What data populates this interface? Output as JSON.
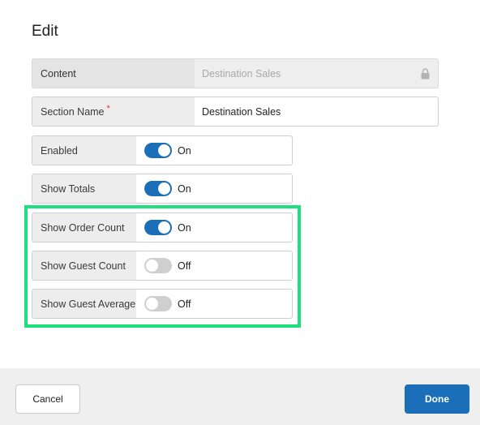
{
  "dialog": {
    "title": "Edit"
  },
  "fields": {
    "content": {
      "label": "Content",
      "value": "Destination Sales",
      "locked": true
    },
    "section_name": {
      "label": "Section Name",
      "required_mark": "*",
      "value": "Destination Sales"
    }
  },
  "toggles": [
    {
      "label": "Enabled",
      "state": "On",
      "on": true
    },
    {
      "label": "Show Totals",
      "state": "On",
      "on": true
    },
    {
      "label": "Show Order Count",
      "state": "On",
      "on": true
    },
    {
      "label": "Show Guest Count",
      "state": "Off",
      "on": false
    },
    {
      "label": "Show Guest Average",
      "state": "Off",
      "on": false
    }
  ],
  "footer": {
    "cancel_label": "Cancel",
    "done_label": "Done"
  },
  "colors": {
    "primary": "#1a6fb8",
    "highlight": "#1ee07f",
    "toggle_off": "#cfcfcf"
  },
  "icons": {
    "content_lock": "lock-icon"
  }
}
